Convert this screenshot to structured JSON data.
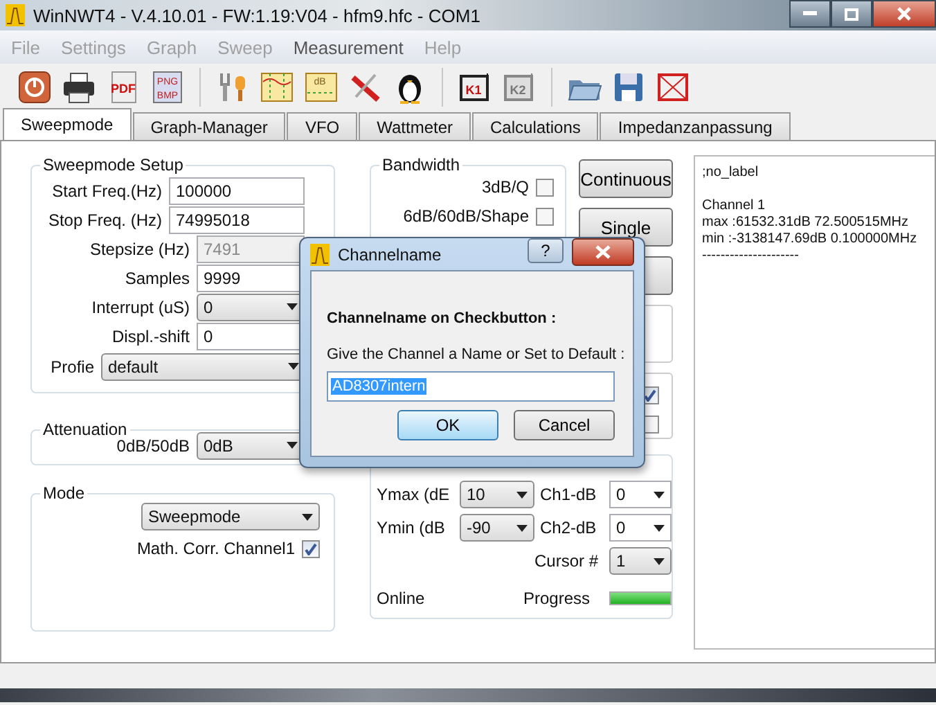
{
  "window": {
    "title": "WinNWT4 - V.4.10.01 - FW:1.19:V04 - hfm9.hfc - COM1"
  },
  "menu": [
    {
      "label": "File",
      "disabled": true
    },
    {
      "label": "Settings",
      "disabled": true
    },
    {
      "label": "Graph",
      "disabled": true
    },
    {
      "label": "Sweep",
      "disabled": true
    },
    {
      "label": "Measurement",
      "disabled": false
    },
    {
      "label": "Help",
      "disabled": true
    }
  ],
  "toolbar": [
    [
      {
        "kind": "power"
      },
      {
        "kind": "printer"
      },
      {
        "kind": "pdf",
        "labels": [
          "PDF"
        ]
      },
      {
        "kind": "image",
        "labels": [
          "PNG",
          "BMP"
        ]
      }
    ],
    [
      {
        "kind": "wrench"
      },
      {
        "kind": "graph"
      },
      {
        "kind": "db",
        "labels": [
          "dB"
        ]
      },
      {
        "kind": "tools"
      },
      {
        "kind": "penguin"
      }
    ],
    [
      {
        "kind": "k",
        "labels": [
          "K1"
        ]
      },
      {
        "kind": "kgrey",
        "labels": [
          "K2"
        ]
      }
    ],
    [
      {
        "kind": "folder"
      },
      {
        "kind": "floppy"
      },
      {
        "kind": "frame"
      }
    ]
  ],
  "tabs": [
    {
      "label": "Sweepmode",
      "selected": true
    },
    {
      "label": "Graph-Manager",
      "selected": false
    },
    {
      "label": "VFO",
      "selected": false
    },
    {
      "label": "Wattmeter",
      "selected": false
    },
    {
      "label": "Calculations",
      "selected": false
    },
    {
      "label": "Impedanzanpassung",
      "selected": false
    }
  ],
  "sweep_setup": {
    "title": "Sweepmode Setup",
    "fields": [
      {
        "label": "Start Freq.(Hz)",
        "value": "100000",
        "kind": "text"
      },
      {
        "label": "Stop Freq. (Hz)",
        "value": "74995018",
        "kind": "text"
      },
      {
        "label": "Stepsize (Hz)",
        "value": "7491",
        "kind": "readonly"
      },
      {
        "label": "Samples",
        "value": "9999",
        "kind": "text"
      },
      {
        "label": "Interrupt (uS)",
        "value": "0",
        "kind": "select"
      },
      {
        "label": "Displ.-shift",
        "value": "0",
        "kind": "text"
      }
    ],
    "profile": {
      "label": "Profie",
      "value": "default"
    }
  },
  "attenuation": {
    "title": "Attenuation",
    "label": "0dB/50dB",
    "value": "0dB"
  },
  "mode": {
    "title": "Mode",
    "value": "Sweepmode",
    "checkbox": {
      "label": "Math. Corr. Channel1",
      "checked": true
    }
  },
  "bandwidth": {
    "title": "Bandwidth",
    "options": [
      {
        "label": "3dB/Q",
        "checked": false
      },
      {
        "label": "6dB/60dB/Shape",
        "checked": false
      }
    ]
  },
  "sweep_buttons": [
    "Continuous",
    "Single"
  ],
  "covered_checkboxes": [
    {
      "checked": true
    },
    {
      "checked": false
    }
  ],
  "display": {
    "ymax": {
      "label": "Ymax (dE",
      "value": "10"
    },
    "ch1": {
      "label": "Ch1-dB",
      "value": "0"
    },
    "ymin": {
      "label": "Ymin (dB",
      "value": "-90"
    },
    "ch2": {
      "label": "Ch2-dB",
      "value": "0"
    },
    "cursor": {
      "label": "Cursor #",
      "value": "1"
    },
    "status": "Online",
    "progress": {
      "label": "Progress",
      "level": 1
    }
  },
  "log": {
    "blocks": [
      [
        ";no_label"
      ],
      [
        "Channel 1",
        "max :61532.31dB 72.500515MHz",
        "min :-3138147.69dB 0.100000MHz",
        "---------------------"
      ]
    ]
  },
  "dialog": {
    "title": "Channelname",
    "help": "?",
    "heading": "Channelname on Checkbutton :",
    "prompt": "Give the Channel a Name or Set to Default :",
    "input": {
      "value": "AD8307intern",
      "selected": true
    },
    "buttons": [
      {
        "label": "OK",
        "default": true
      },
      {
        "label": "Cancel",
        "default": false
      }
    ]
  }
}
